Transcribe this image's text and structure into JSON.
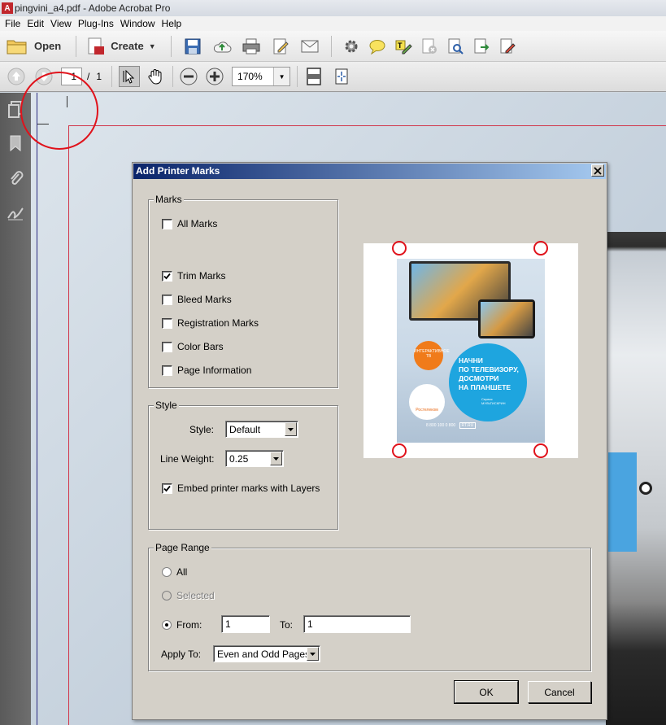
{
  "window": {
    "title": "pingvini_a4.pdf - Adobe Acrobat Pro"
  },
  "menu": [
    "File",
    "Edit",
    "View",
    "Plug-Ins",
    "Window",
    "Help"
  ],
  "toolbar": {
    "open_label": "Open",
    "create_label": "Create",
    "page_current": "1",
    "page_sep": "/",
    "page_total": "1",
    "zoom": "170%"
  },
  "dialog": {
    "title": "Add Printer Marks",
    "marks": {
      "group_label": "Marks",
      "all_marks": "All Marks",
      "trim_marks": "Trim Marks",
      "bleed_marks": "Bleed Marks",
      "registration_marks": "Registration Marks",
      "color_bars": "Color Bars",
      "page_information": "Page Information"
    },
    "style": {
      "group_label": "Style",
      "style_label": "Style:",
      "style_value": "Default",
      "line_weight_label": "Line Weight:",
      "line_weight_value": "0.25",
      "embed_layers": "Embed printer marks with Layers"
    },
    "page_range": {
      "group_label": "Page Range",
      "all": "All",
      "selected": "Selected",
      "from_label": "From:",
      "from_value": "1",
      "to_label": "To:",
      "to_value": "1",
      "apply_to_label": "Apply To:",
      "apply_to_value": "Even and Odd Pages"
    },
    "ok": "OK",
    "cancel": "Cancel",
    "preview": {
      "orange_text": "ИНТЕРАКТИВНОЕ ТВ",
      "blue_text_1": "НАЧНИ",
      "blue_text_2": "ПО ТЕЛЕВИЗОРУ,",
      "blue_text_3": "ДОСМОТРИ",
      "blue_text_4": "НА ПЛАНШЕТЕ",
      "blue_service": "Сервис МУЛЬТИСКРИН",
      "logo_text": "Ростелеком",
      "phone": "8 800 100 0 800",
      "site": "RT.RU"
    }
  },
  "state": {
    "all_marks_checked": false,
    "trim_marks_checked": true,
    "bleed_marks_checked": false,
    "registration_marks_checked": false,
    "color_bars_checked": false,
    "page_information_checked": false,
    "embed_layers_checked": true,
    "page_range_selection": "from"
  },
  "colors": {
    "dialog_bg": "#d4d0c8",
    "title_gradient_start": "#0a246a",
    "annotation_red": "#e0121b",
    "trim_line": "#d1364a"
  }
}
